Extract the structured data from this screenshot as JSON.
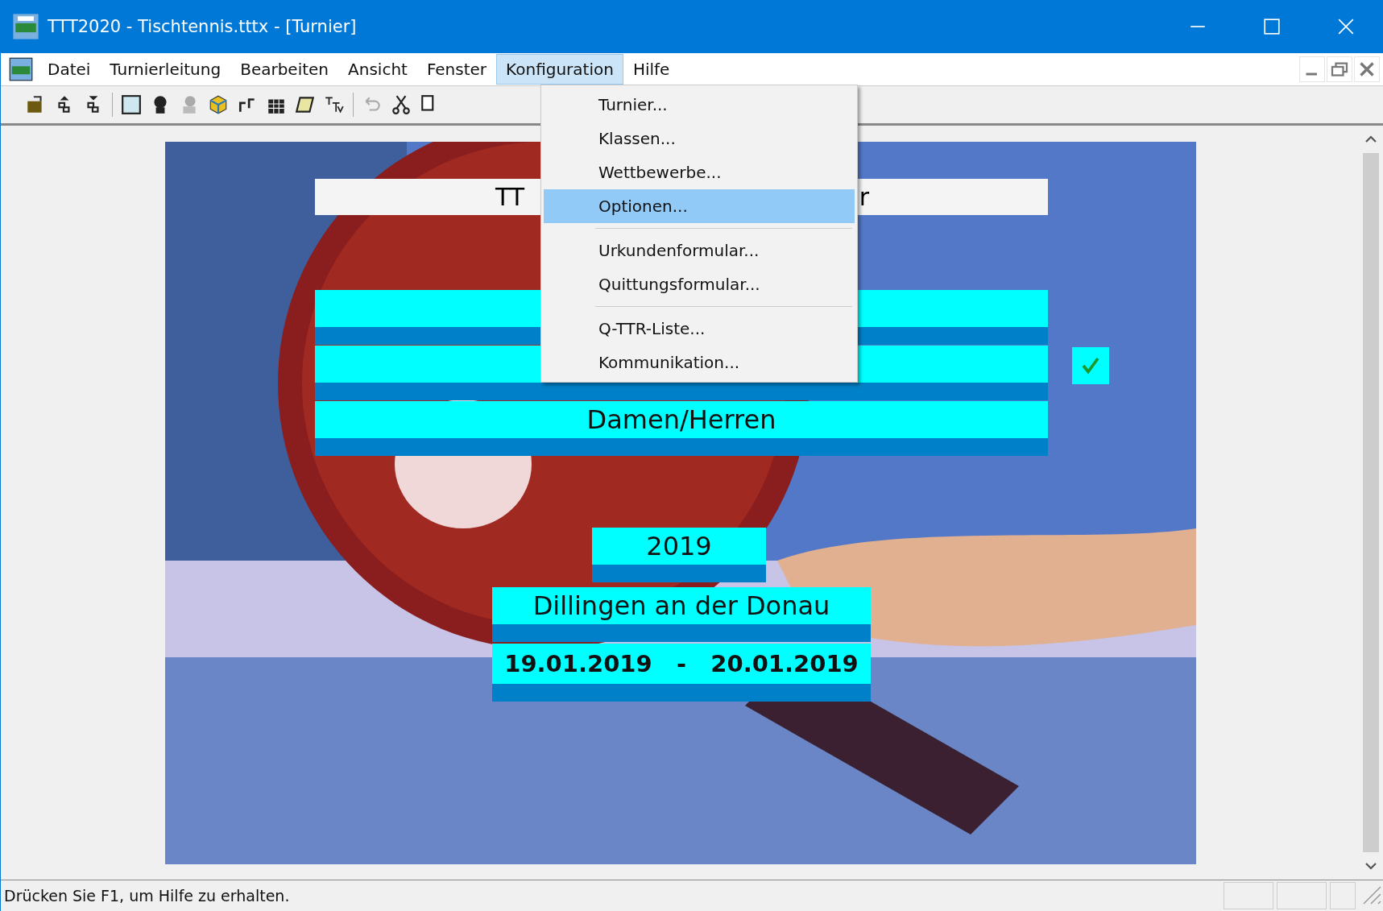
{
  "window": {
    "title": "TTT2020 - Tischtennis.tttx - [Turnier]"
  },
  "menu_bar": [
    {
      "label": "Datei",
      "selected": false
    },
    {
      "label": "Turnierleitung",
      "selected": false
    },
    {
      "label": "Bearbeiten",
      "selected": false
    },
    {
      "label": "Ansicht",
      "selected": false
    },
    {
      "label": "Fenster",
      "selected": false
    },
    {
      "label": "Konfiguration",
      "selected": true
    },
    {
      "label": "Hilfe",
      "selected": false
    }
  ],
  "dropdown": [
    {
      "kind": "item",
      "label": "Turnier...",
      "selected": false
    },
    {
      "kind": "item",
      "label": "Klassen...",
      "selected": false
    },
    {
      "kind": "item",
      "label": "Wettbewerbe...",
      "selected": false
    },
    {
      "kind": "item",
      "label": "Optionen...",
      "selected": true
    },
    {
      "kind": "separator"
    },
    {
      "kind": "item",
      "label": "Urkundenformular...",
      "selected": false
    },
    {
      "kind": "item",
      "label": "Quittungsformular...",
      "selected": false
    },
    {
      "kind": "separator"
    },
    {
      "kind": "item",
      "label": "Q-TTR-Liste...",
      "selected": false
    },
    {
      "kind": "item",
      "label": "Kommunikation...",
      "selected": false
    }
  ],
  "tournament": {
    "title_left": "TT",
    "title_right": "r",
    "row_3": "Damen/Herren",
    "checked": true,
    "year": "2019",
    "place": "Dillingen an der Donau",
    "dates": "19.01.2019   -   20.01.2019"
  },
  "status_bar": {
    "text": "Drücken Sie F1, um Hilfe zu erhalten."
  }
}
